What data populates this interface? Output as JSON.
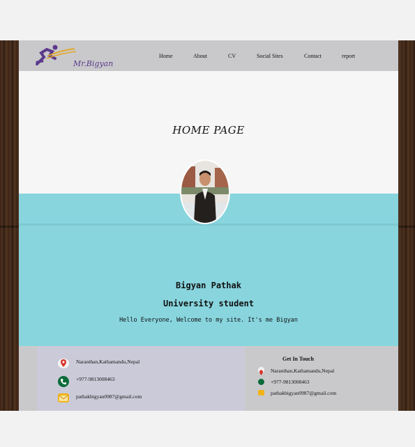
{
  "brand": {
    "logo_text": "Mr.Bigyan"
  },
  "nav": {
    "items": [
      "Home",
      "About",
      "CV",
      "Social Sites",
      "Contact",
      "report"
    ]
  },
  "hero": {
    "title": "HOME PAGE",
    "name": "Bigyan Pathak",
    "role": "University student",
    "welcome": "Hello Everyone, Welcome to my site. It's me Bigyan"
  },
  "footer": {
    "address": "Naranthan,Kathamandu,Nepal",
    "phone": "+977-9813008463",
    "email": "pathakbigyan0987@gmail.com",
    "get_in_touch": "Get In Touch",
    "touch_address": "Naranthan,Kathamandu,Nepal",
    "touch_phone": "+977-9813008463",
    "touch_email": "pathakbigyan0987@gmail.com"
  },
  "colors": {
    "nav_bg": "#c9c9cb",
    "teal": "#88d5de",
    "logo_purple": "#5b3a8c",
    "logo_gold": "#e2a72b",
    "phone_green": "#0c6b3a",
    "location_red": "#d9362c",
    "email_yellow": "#f2b318"
  }
}
